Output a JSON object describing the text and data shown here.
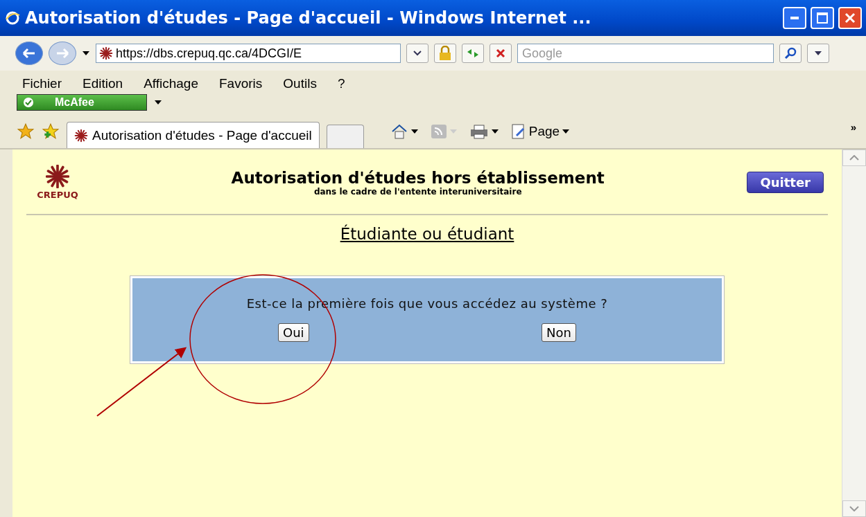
{
  "window": {
    "title": "Autorisation d'études - Page d'accueil - Windows Internet ..."
  },
  "address_bar": {
    "url": "https://dbs.crepuq.qc.ca/4DCGI/E",
    "search_placeholder": "Google"
  },
  "menu": [
    "Fichier",
    "Edition",
    "Affichage",
    "Favoris",
    "Outils",
    "?"
  ],
  "addon_bar": {
    "label": "McAfee"
  },
  "tab_bar": {
    "tabs": [
      {
        "label": "Autorisation d'études - Page d'accueil",
        "selected": true
      }
    ],
    "page_menu": "Page",
    "more": "»"
  },
  "page": {
    "logo_text": "CREPUQ",
    "title": "Autorisation d'études hors établissement",
    "subtitle": "dans le cadre de l'entente interuniversitaire",
    "quit_button": "Quitter",
    "heading": "Étudiante ou étudiant",
    "question": "Est-ce la première fois que vous accédez au système ?",
    "answers": [
      "Oui",
      "Non"
    ]
  }
}
